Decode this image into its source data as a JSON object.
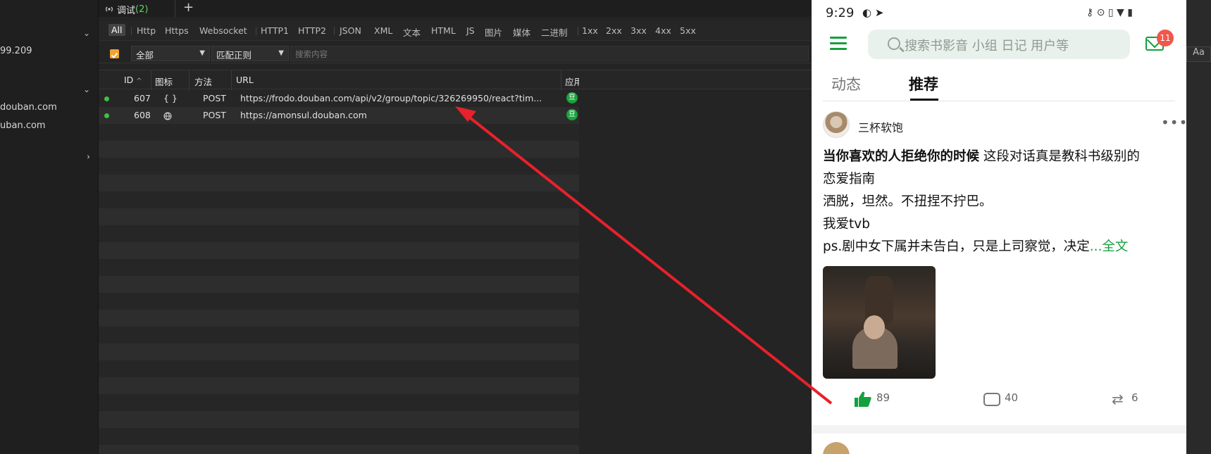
{
  "sidebar": {
    "items": [
      "99.209",
      "douban.com",
      "uban.com"
    ]
  },
  "tabs": {
    "label": "调试",
    "count": "(2)",
    "add": "+"
  },
  "filters": {
    "items": [
      "All",
      "Http",
      "Https",
      "Websocket",
      "HTTP1",
      "HTTP2",
      "JSON",
      "XML",
      "文本",
      "HTML",
      "JS",
      "图片",
      "媒体",
      "二进制",
      "1xx",
      "2xx",
      "3xx",
      "4xx",
      "5xx"
    ],
    "active": "All"
  },
  "search": {
    "scope_value": "全部",
    "match_value": "匹配正则",
    "placeholder": "搜索内容",
    "case_button": "Aa"
  },
  "table": {
    "columns": [
      "ID",
      "图标",
      "方法",
      "URL",
      "应用"
    ],
    "rows": [
      {
        "id": "607",
        "icon": "{ }",
        "method": "POST",
        "url": "https://frodo.douban.com/api/v2/group/topic/326269950/react?tim...",
        "app_badge": "豆"
      },
      {
        "id": "608",
        "icon": "globe-icon",
        "method": "POST",
        "url": "https://amonsul.douban.com",
        "app_badge": "豆"
      }
    ]
  },
  "phone": {
    "status_time": "9:29",
    "search_placeholder": "搜索书影音 小组 日记 用户等",
    "mail_badge": "11",
    "tabs": [
      "动态",
      "推荐"
    ],
    "active_tab": "推荐",
    "post": {
      "author": "三杯软饱",
      "title": "当你喜欢的人拒绝你的时候",
      "line1_rest": " 这段对话真是教科书级别的",
      "line2": "恋爱指南",
      "line3": "洒脱，坦然。不扭捏不拧巴。",
      "line4": "我爱tvb",
      "line5": "ps.剧中女下属并未告白，只是上司察觉，决定",
      "more_link": "...全文",
      "likes": "89",
      "comments": "40",
      "reshares": "6"
    }
  },
  "colors": {
    "accent_green": "#14a03e",
    "arrow_red": "#e8212b",
    "filter_check": "#f0a331"
  }
}
